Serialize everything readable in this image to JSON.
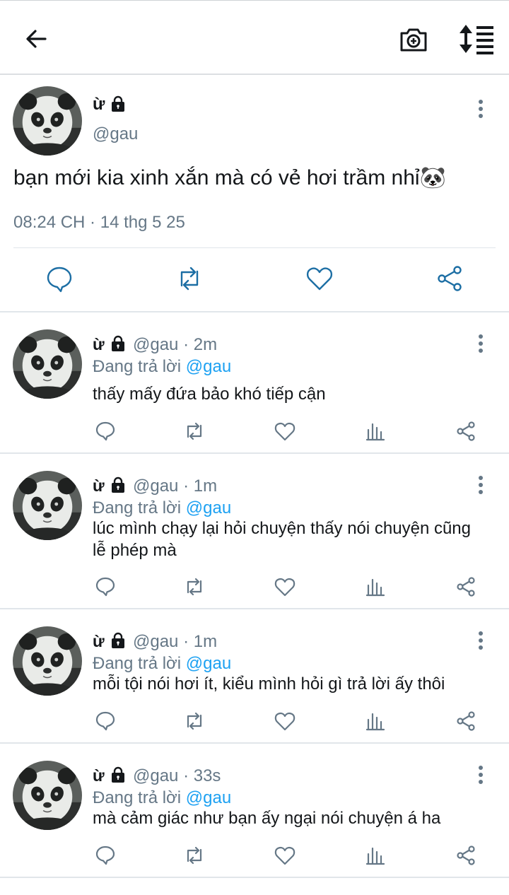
{
  "header": {
    "back_icon": "arrow-left-icon",
    "camera_icon": "camera-plus-icon",
    "sort_icon": "sort-icon"
  },
  "tweet": {
    "display_name": "ừ",
    "handle": "@gau",
    "text": "bạn mới kia xinh xắn mà có vẻ hơi trầm nhỉ🐼",
    "timestamp": "08:24 CH · 14 thg 5 25"
  },
  "replies": [
    {
      "display_name": "ừ",
      "handle_time": "@gau · 2m",
      "replying_prefix": "Đang trả lời",
      "mention": "@gau",
      "text": "thấy mấy đứa bảo khó tiếp cận"
    },
    {
      "display_name": "ừ",
      "handle_time": "@gau · 1m",
      "replying_prefix": "Đang trả lời",
      "mention": "@gau",
      "text": "lúc mình chạy lại hỏi chuyện thấy nói chuyện cũng lễ phép mà"
    },
    {
      "display_name": "ừ",
      "handle_time": "@gau · 1m",
      "replying_prefix": "Đang trả lời",
      "mention": "@gau",
      "text": "mỗi tội nói hơi ít, kiểu mình hỏi gì trả lời ấy thôi"
    },
    {
      "display_name": "ừ",
      "handle_time": "@gau · 33s",
      "replying_prefix": "Đang trả lời",
      "mention": "@gau",
      "text": "mà cảm giác như bạn ấy ngại nói chuyện á ha"
    }
  ],
  "colors": {
    "text": "#14171a",
    "muted": "#657786",
    "link": "#1da1f2",
    "divider": "#e1e6ea"
  }
}
